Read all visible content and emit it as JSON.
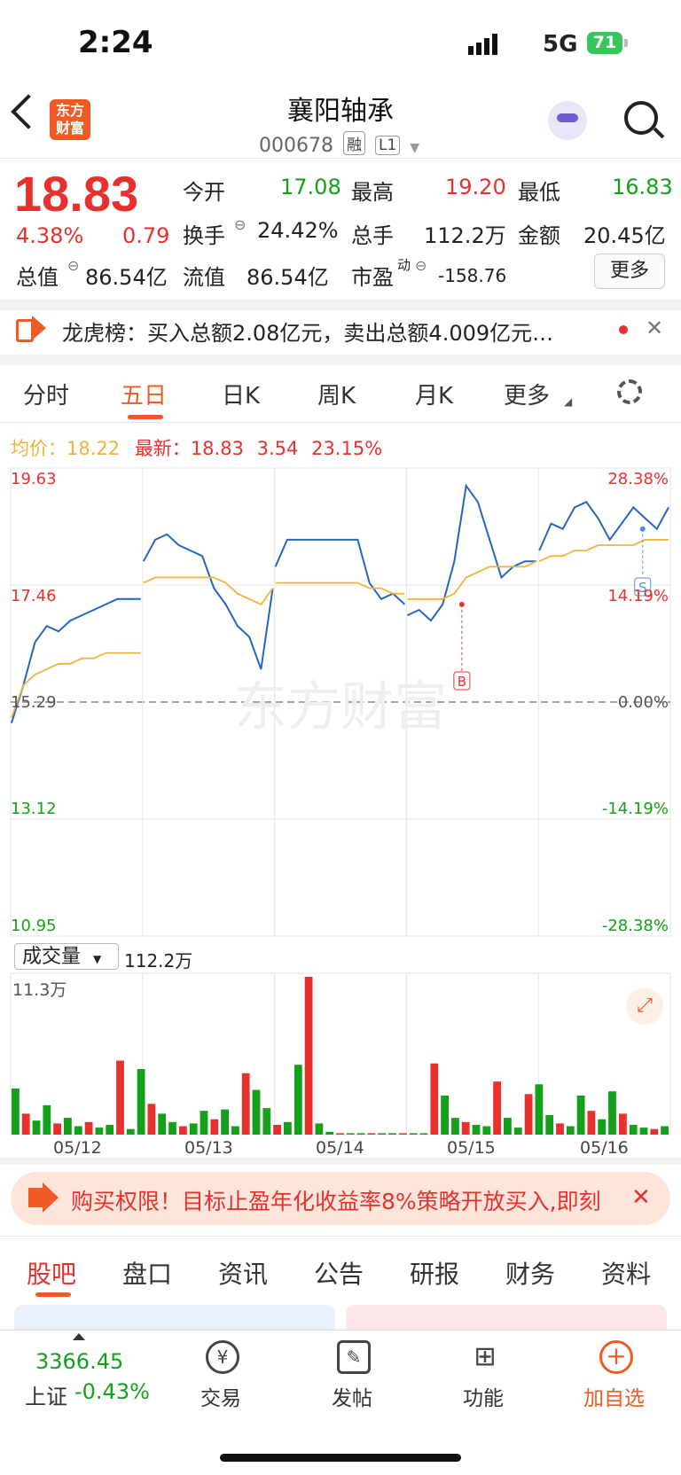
{
  "status_bar": {
    "time": "2:24",
    "network": "5G",
    "battery": "71"
  },
  "header": {
    "logo_text": "东方\n财富",
    "stock_name": "襄阳轴承",
    "code": "000678",
    "tag_margin": "融",
    "tag_level": "L1"
  },
  "quote": {
    "price": "18.83",
    "change_pct": "4.38%",
    "change": "0.79",
    "fields": [
      {
        "label": "今开",
        "value": "17.08",
        "color": "green"
      },
      {
        "label": "最高",
        "value": "19.20",
        "color": "red"
      },
      {
        "label": "最低",
        "value": "16.83",
        "color": "green"
      },
      {
        "label": "换手",
        "value": "24.42%",
        "color": "default"
      },
      {
        "label": "总手",
        "value": "112.2万",
        "color": "default"
      },
      {
        "label": "金额",
        "value": "20.45亿",
        "color": "default"
      },
      {
        "label": "总值",
        "value": "86.54亿",
        "color": "default"
      },
      {
        "label": "流值",
        "value": "86.54亿",
        "color": "default"
      },
      {
        "label": "市盈",
        "superscript": "动",
        "value": "-158.76",
        "color": "default"
      }
    ],
    "more_button": "更多"
  },
  "notice": {
    "text": "龙虎榜：买入总额2.08亿元，卖出总额4.009亿元…"
  },
  "chart_tabs": [
    "分时",
    "五日",
    "日K",
    "周K",
    "月K",
    "更多"
  ],
  "chart_info": {
    "avg_label": "均价：",
    "avg_value": "18.22",
    "latest_label": "最新：",
    "latest_value": "18.83",
    "latest_change": "3.54",
    "latest_pct": "23.15%"
  },
  "chart_data": {
    "type": "line",
    "title": "",
    "y_left_ticks": [
      "19.63",
      "17.46",
      "15.29",
      "13.12",
      "10.95"
    ],
    "y_right_ticks": [
      "28.38%",
      "14.19%",
      "0.00%",
      "-14.19%",
      "-28.38%"
    ],
    "ylim": [
      10.95,
      19.63
    ],
    "base_price": 15.29,
    "x_dates": [
      "05/12",
      "05/13",
      "05/14",
      "05/15",
      "05/16"
    ],
    "series": [
      {
        "name": "",
        "color": "#2566c4",
        "values": [
          14.9,
          15.6,
          16.4,
          16.7,
          16.6,
          16.8,
          16.9,
          17.0,
          17.1,
          17.2,
          17.2,
          17.2,
          17.9,
          18.3,
          18.4,
          18.2,
          18.1,
          18.0,
          17.4,
          17.1,
          16.7,
          16.5,
          15.9,
          17.4,
          17.8,
          18.3,
          18.3,
          18.3,
          18.3,
          18.3,
          18.3,
          18.3,
          17.5,
          17.2,
          17.3,
          17.1,
          16.9,
          17.0,
          16.8,
          17.1,
          17.9,
          19.3,
          19.0,
          18.3,
          17.6,
          17.8,
          17.9,
          17.9,
          18.1,
          18.6,
          18.5,
          18.9,
          19.0,
          18.7,
          18.3,
          18.6,
          18.9,
          18.7,
          18.5,
          18.9
        ]
      },
      {
        "name": "",
        "color": "#f0b43a",
        "values": [
          15.0,
          15.6,
          15.8,
          15.9,
          16.0,
          16.0,
          16.1,
          16.1,
          16.2,
          16.2,
          16.2,
          16.2,
          17.5,
          17.6,
          17.6,
          17.6,
          17.6,
          17.6,
          17.6,
          17.5,
          17.3,
          17.2,
          17.1,
          17.4,
          17.5,
          17.5,
          17.5,
          17.5,
          17.5,
          17.5,
          17.5,
          17.5,
          17.4,
          17.4,
          17.3,
          17.3,
          17.2,
          17.2,
          17.2,
          17.2,
          17.3,
          17.6,
          17.7,
          17.8,
          17.8,
          17.8,
          17.8,
          17.9,
          17.9,
          18.0,
          18.0,
          18.1,
          18.1,
          18.2,
          18.2,
          18.2,
          18.2,
          18.3,
          18.3,
          18.3
        ]
      }
    ],
    "markers": [
      {
        "label": "B",
        "color": "#e8312f"
      },
      {
        "label": "S",
        "color": "#4a90e2"
      }
    ],
    "watermark": "东方财富",
    "volume": {
      "label": "成交量",
      "total": "112.2万",
      "max_label": "11.3万",
      "ylim": [
        0,
        11.3
      ],
      "bars": [
        3.3,
        1.5,
        1.0,
        2.1,
        0.8,
        1.2,
        0.6,
        0.9,
        0.5,
        0.7,
        5.3,
        0.4,
        4.7,
        2.2,
        1.5,
        0.9,
        0.6,
        0.8,
        1.7,
        1.1,
        1.8,
        0.6,
        4.4,
        3.2,
        1.9,
        0.7,
        0.9,
        5.0,
        11.3,
        0.8,
        0.2,
        0.1,
        0.1,
        0.1,
        0.1,
        0.1,
        0.1,
        0.1,
        0.1,
        0.1,
        5.1,
        2.8,
        1.2,
        0.9,
        0.7,
        0.6,
        3.8,
        1.2,
        0.5,
        2.9,
        3.6,
        1.4,
        0.8,
        0.6,
        2.8,
        1.7,
        1.1,
        3.1,
        1.5,
        0.7,
        0.5,
        0.4,
        0.6
      ]
    }
  },
  "promo": {
    "text": "购买权限！目标止盈年化收益率8%策略开放买入,即刻"
  },
  "bottom_tabs": [
    "股吧",
    "盘口",
    "资讯",
    "公告",
    "研报",
    "财务",
    "资料"
  ],
  "index": {
    "value": "3366.45",
    "name": "上证",
    "pct": "-0.43%"
  },
  "nav": [
    {
      "label": "交易",
      "icon": "yen-exchange-icon"
    },
    {
      "label": "发帖",
      "icon": "edit-icon"
    },
    {
      "label": "功能",
      "icon": "grid-icon"
    },
    {
      "label": "加自选",
      "icon": "add-icon"
    }
  ]
}
